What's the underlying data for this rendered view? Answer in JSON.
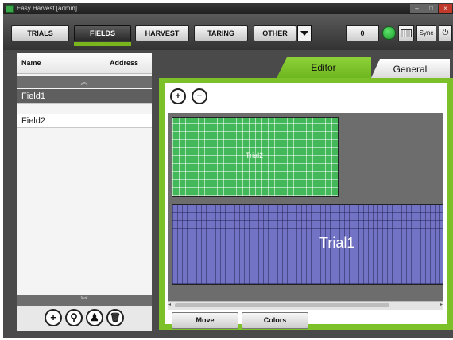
{
  "window": {
    "title": "Easy Harvest [admin]",
    "controls": {
      "minimize": "–",
      "maximize": "□",
      "close": "×"
    }
  },
  "toolbar": {
    "trials_label": "TRIALS",
    "fields_label": "FIELDS",
    "harvest_label": "HARVEST",
    "taring_label": "TARING",
    "other_label": "OTHER",
    "counter_value": "0",
    "keyboard_icon": "keyboard-icon",
    "sync_label": "Sync",
    "power_symbol": "⏻",
    "status_color": "#2ebf3e",
    "active_tab_color": "#7ab51d"
  },
  "sidebar": {
    "columns": {
      "name": "Name",
      "address": "Address"
    },
    "scroll_up_glyph": "︽",
    "scroll_down_glyph": "︾",
    "fields": [
      "Field1",
      "Field2"
    ],
    "selected_index": 0,
    "icons": {
      "add_glyph": "+",
      "search_glyph": "⚲",
      "user_glyph": "♟",
      "delete_glyph": "🗑"
    }
  },
  "tabs": {
    "editor": "Editor",
    "general": "General",
    "active": "editor"
  },
  "editor": {
    "zoom_in_glyph": "+",
    "zoom_out_glyph": "−",
    "trials": [
      {
        "label": "Trial2",
        "color": "#43b85a"
      },
      {
        "label": "Trial1",
        "color": "#7273c4"
      }
    ],
    "move_label": "Move",
    "colors_label": "Colors",
    "scroll_left_glyph": "◂",
    "scroll_right_glyph": "▸"
  }
}
